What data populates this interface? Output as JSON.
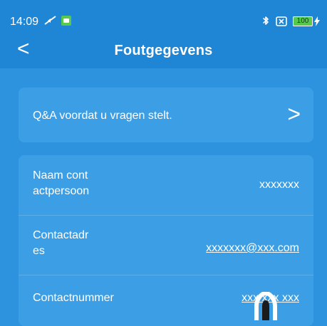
{
  "status": {
    "time": "14:09",
    "battery": "100"
  },
  "header": {
    "title": "Foutgegevens",
    "back": "<"
  },
  "qa": {
    "label": "Q&A voordat u vragen stelt.",
    "arrow": ">"
  },
  "contact": {
    "rows": [
      {
        "label": "Naam cont\nactpersoon",
        "value": "xxxxxxx"
      },
      {
        "label": "Contactadr\nes",
        "value": "xxxxxxx@xxx.com"
      },
      {
        "label": "Contactnummer",
        "value": "xxx xxx xxx"
      }
    ]
  },
  "colors": {
    "background": "#2d93df",
    "header": "#1f86d6",
    "card": "#3c9fe6"
  }
}
